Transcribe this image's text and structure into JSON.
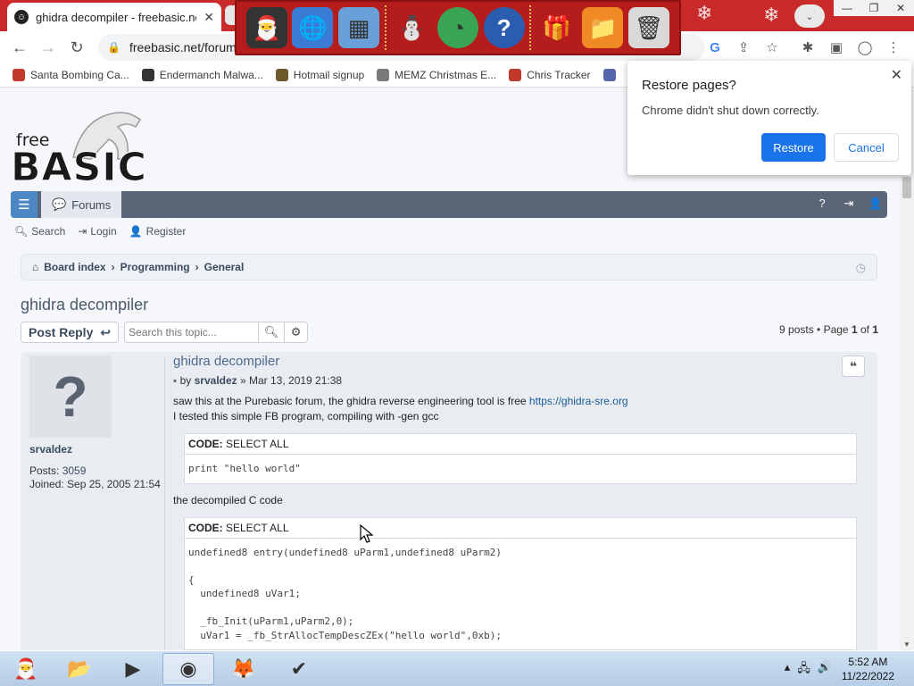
{
  "browser": {
    "tab_title": "ghidra decompiler - freebasic.net",
    "url": "freebasic.net/forum",
    "bookmarks": [
      {
        "label": "Santa Bombing Ca...",
        "color": "#c0392b"
      },
      {
        "label": "Endermanch Malwa...",
        "color": "#333333"
      },
      {
        "label": "Hotmail signup",
        "color": "#6b5b2a"
      },
      {
        "label": "MEMZ Christmas E...",
        "color": "#7a7a7a"
      },
      {
        "label": "Chris Tracker",
        "color": "#c0392b"
      }
    ]
  },
  "restore_dialog": {
    "title": "Restore pages?",
    "message": "Chrome didn't shut down correctly.",
    "restore_label": "Restore",
    "cancel_label": "Cancel"
  },
  "site": {
    "logo_free": "free",
    "logo_basic": "BASIC",
    "nav_forums": "Forums",
    "subnav": {
      "search": "Search",
      "login": "Login",
      "register": "Register"
    },
    "breadcrumbs": [
      "Board index",
      "Programming",
      "General"
    ]
  },
  "topic": {
    "title": "ghidra decompiler",
    "post_reply": "Post Reply",
    "search_placeholder": "Search this topic...",
    "pagination_prefix": "9 posts • Page ",
    "page_current": "1",
    "page_of": " of ",
    "page_total": "1"
  },
  "post": {
    "title": "ghidra decompiler",
    "by": "by ",
    "author": "srvaldez",
    "date": " » Mar 13, 2019 21:38",
    "line1": "saw this at the Purebasic forum, the ghidra reverse engineering tool is free ",
    "link": "https://ghidra-sre.org",
    "line2": "I tested this simple FB program, compiling with -gen gcc",
    "code_label": "CODE: ",
    "select_all": "SELECT ALL",
    "code1": "print \"hello world\"",
    "middle_text": "the decompiled C code",
    "code2": "undefined8 entry(undefined8 uParm1,undefined8 uParm2)\n\n{\n  undefined8 uVar1;\n\n  _fb_Init(uParm1,uParm2,0);\n  uVar1 = _fb_StrAllocTempDescZEx(\"hello world\",0xb);"
  },
  "profile": {
    "username": "srvaldez",
    "posts_label": "Posts: ",
    "posts_value": "3059",
    "joined_label": "Joined: ",
    "joined_value": "Sep 25, 2005 21:54"
  },
  "taskbar": {
    "time": "5:52 AM",
    "date": "11/22/2022"
  }
}
